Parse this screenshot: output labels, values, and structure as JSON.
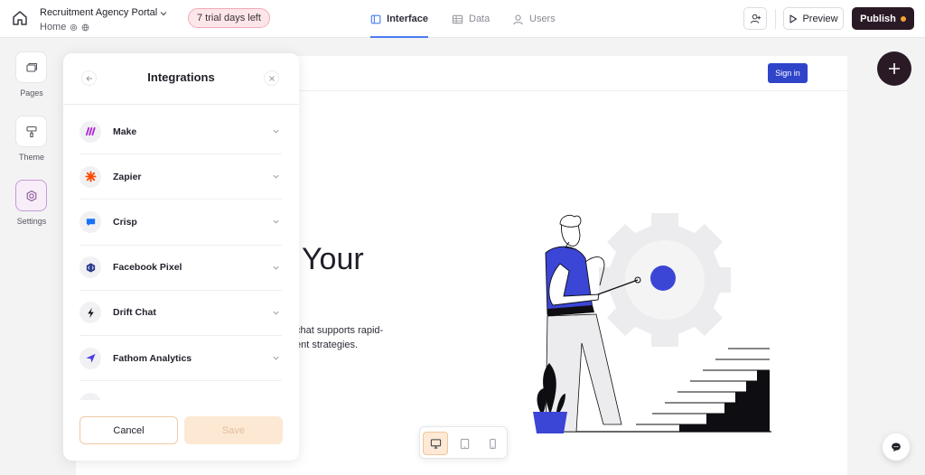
{
  "topbar": {
    "app_title": "Recruitment Agency Portal",
    "breadcrumb": "Home",
    "trial_badge": "7 trial days left",
    "tabs": [
      {
        "label": "Interface",
        "icon": "layout-icon",
        "active": true
      },
      {
        "label": "Data",
        "icon": "table-icon",
        "active": false
      },
      {
        "label": "Users",
        "icon": "user-icon",
        "active": false
      }
    ],
    "preview_label": "Preview",
    "publish_label": "Publish"
  },
  "sidebar": {
    "items": [
      {
        "label": "Pages",
        "icon": "pages-icon",
        "active": false
      },
      {
        "label": "Theme",
        "icon": "paint-roller-icon",
        "active": false
      },
      {
        "label": "Settings",
        "icon": "settings-icon",
        "active": true
      }
    ]
  },
  "panel": {
    "title": "Integrations",
    "integrations": [
      {
        "name": "Make",
        "icon": "make-logo-icon"
      },
      {
        "name": "Zapier",
        "icon": "zapier-logo-icon"
      },
      {
        "name": "Crisp",
        "icon": "crisp-logo-icon"
      },
      {
        "name": "Facebook Pixel",
        "icon": "facebook-pixel-logo-icon"
      },
      {
        "name": "Drift Chat",
        "icon": "drift-logo-icon"
      },
      {
        "name": "Fathom Analytics",
        "icon": "fathom-logo-icon"
      }
    ],
    "cancel_label": "Cancel",
    "save_label": "Save"
  },
  "canvas": {
    "signin_label": "Sign in",
    "hero_title": "Your",
    "hero_text_line1": "chat supports rapid-",
    "hero_text_line2": "ent strategies."
  },
  "colors": {
    "accent": "#2f44c9",
    "publish_bg": "#2a1a26",
    "publish_dot": "#f5a431",
    "trial_bg": "#fde6ea",
    "save_bg": "#fde8d3"
  }
}
